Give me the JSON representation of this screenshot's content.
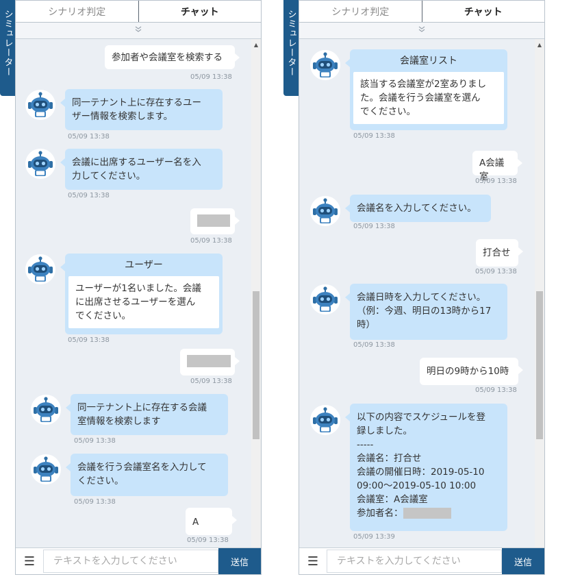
{
  "simulator_tab": "シミュレーター",
  "tabs": {
    "scenario": "シナリオ判定",
    "chat": "チャット"
  },
  "footer": {
    "placeholder": "テキストを入力してください",
    "send": "送信"
  },
  "left": {
    "m1": {
      "text": "参加者や会議室を検索する",
      "time": "05/09 13:38"
    },
    "m2": {
      "l1": "同一テナント上に存在するユー",
      "l2": "ザー情報を検索します。",
      "time": "05/09 13:38"
    },
    "m3": {
      "l1": "会議に出席するユーザー名を入",
      "l2": "力してください。",
      "time": "05/09 13:38"
    },
    "m4": {
      "time": "05/09 13:38"
    },
    "m5": {
      "title": "ユーザー",
      "l1": "ユーザーが1名いました。会議",
      "l2": "に出席させるユーザーを選ん",
      "l3": "でください。",
      "time": "05/09 13:38"
    },
    "m6": {
      "time": "05/09 13:38"
    },
    "m7": {
      "l1": "同一テナント上に存在する会議",
      "l2": "室情報を検索します",
      "time": "05/09 13:38"
    },
    "m8": {
      "l1": "会議を行う会議室名を入力して",
      "l2": "ください。",
      "time": "05/09 13:38"
    },
    "m9": {
      "text": "A",
      "time": "05/09 13:38"
    }
  },
  "right": {
    "m1": {
      "title": "会議室リスト",
      "l1": "該当する会議室が2室ありまし",
      "l2": "た。会議を行う会議室を選ん",
      "l3": "でください。",
      "time": "05/09 13:38"
    },
    "m2": {
      "text": "A会議室",
      "time": "05/09 13:38"
    },
    "m3": {
      "text": "会議名を入力してください。",
      "time": "05/09 13:38"
    },
    "m4": {
      "text": "打合せ",
      "time": "05/09 13:38"
    },
    "m5": {
      "l1": "会議日時を入力してください。",
      "l2": "（例：今週、明日の13時から17",
      "l3": "時）",
      "time": "05/09 13:38"
    },
    "m6": {
      "text": "明日の9時から10時",
      "time": "05/09 13:38"
    },
    "m7": {
      "l1": "以下の内容でスケジュールを登",
      "l2": "録しました。",
      "l3": "-----",
      "l4": "会議名：打合せ",
      "l5": "会議の開催日時：2019-05-10",
      "l6": "09:00～2019-05-10 10:00",
      "l7": "会議室：A会議室",
      "l8": "参加者名：",
      "time": "05/09 13:39"
    }
  }
}
